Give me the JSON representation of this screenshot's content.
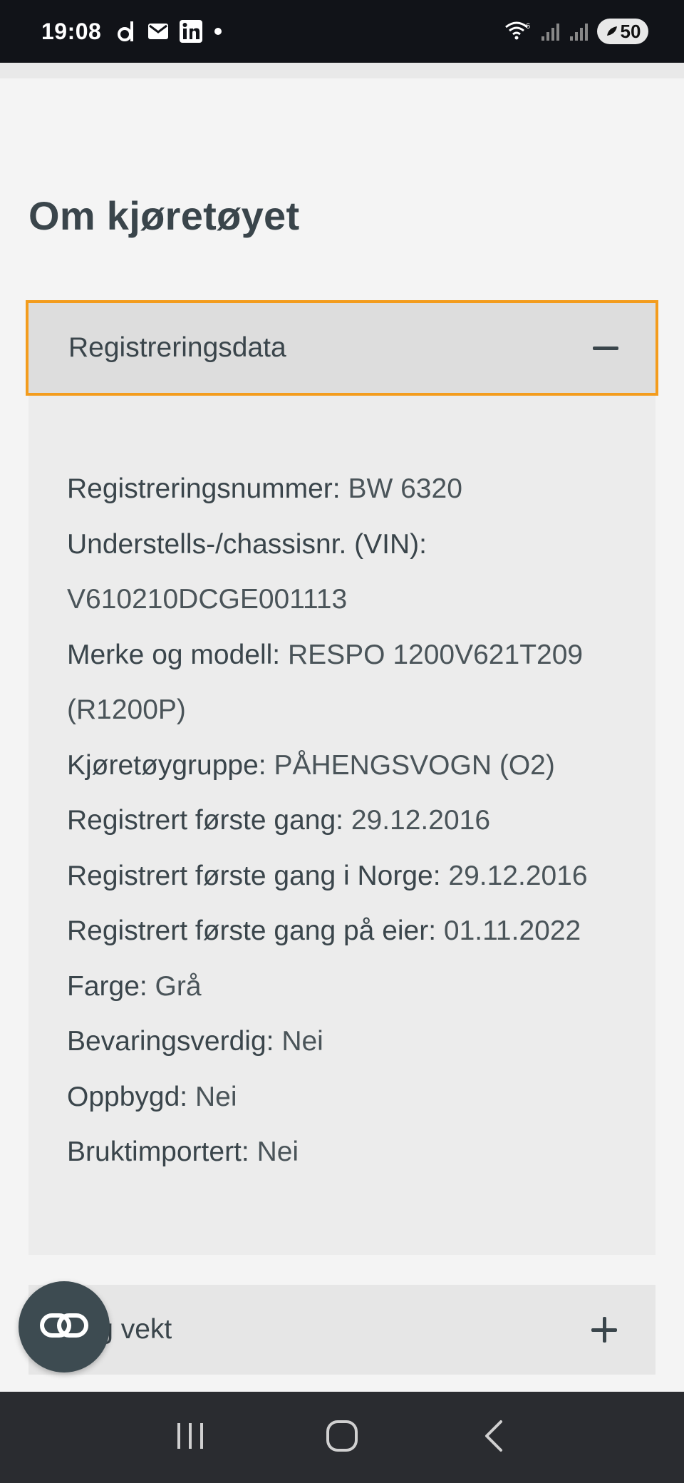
{
  "status_bar": {
    "time": "19:08",
    "battery": "50",
    "icons": [
      "d-app-icon",
      "mail-icon",
      "linkedin-icon",
      "notification-dot-icon",
      "wifi-icon",
      "signal-icon",
      "signal-icon-2",
      "battery-icon"
    ]
  },
  "page": {
    "title": "Om kjøretøyet"
  },
  "accordion_1": {
    "label": "Registreringsdata",
    "expanded": true,
    "toggle_icon": "minus-icon",
    "rows": [
      {
        "key": "Registreringsnummer:",
        "value": " BW 6320"
      },
      {
        "key": "Understells-/chassisnr. (VIN):",
        "value": ""
      },
      {
        "key": "",
        "value": "V610210DCGE001113"
      },
      {
        "key": "Merke og modell:",
        "value": " RESPO 1200V621T209"
      },
      {
        "key": "",
        "value": "(R1200P)"
      },
      {
        "key": "Kjøretøygruppe:",
        "value": " PÅHENGSVOGN (O2)"
      },
      {
        "key": "Registrert første gang:",
        "value": " 29.12.2016"
      },
      {
        "key": "Registrert første gang i Norge:",
        "value": " 29.12.2016"
      },
      {
        "key": "Registrert første gang på eier:",
        "value": " 01.11.2022"
      },
      {
        "key": "Farge:",
        "value": " Grå"
      },
      {
        "key": "Bevaringsverdig:",
        "value": " Nei"
      },
      {
        "key": "Oppbygd:",
        "value": " Nei"
      },
      {
        "key": "Bruktimportert:",
        "value": " Nei"
      }
    ]
  },
  "accordion_2": {
    "label": "l og vekt",
    "expanded": false,
    "toggle_icon": "plus-icon"
  },
  "fab": {
    "icon": "link-icon"
  },
  "nav_bar": {
    "buttons": [
      "recents-icon",
      "home-icon",
      "back-icon"
    ]
  },
  "colors": {
    "accent_border": "#f39c1d",
    "text": "#3a454b",
    "fab": "#3d4b51"
  }
}
